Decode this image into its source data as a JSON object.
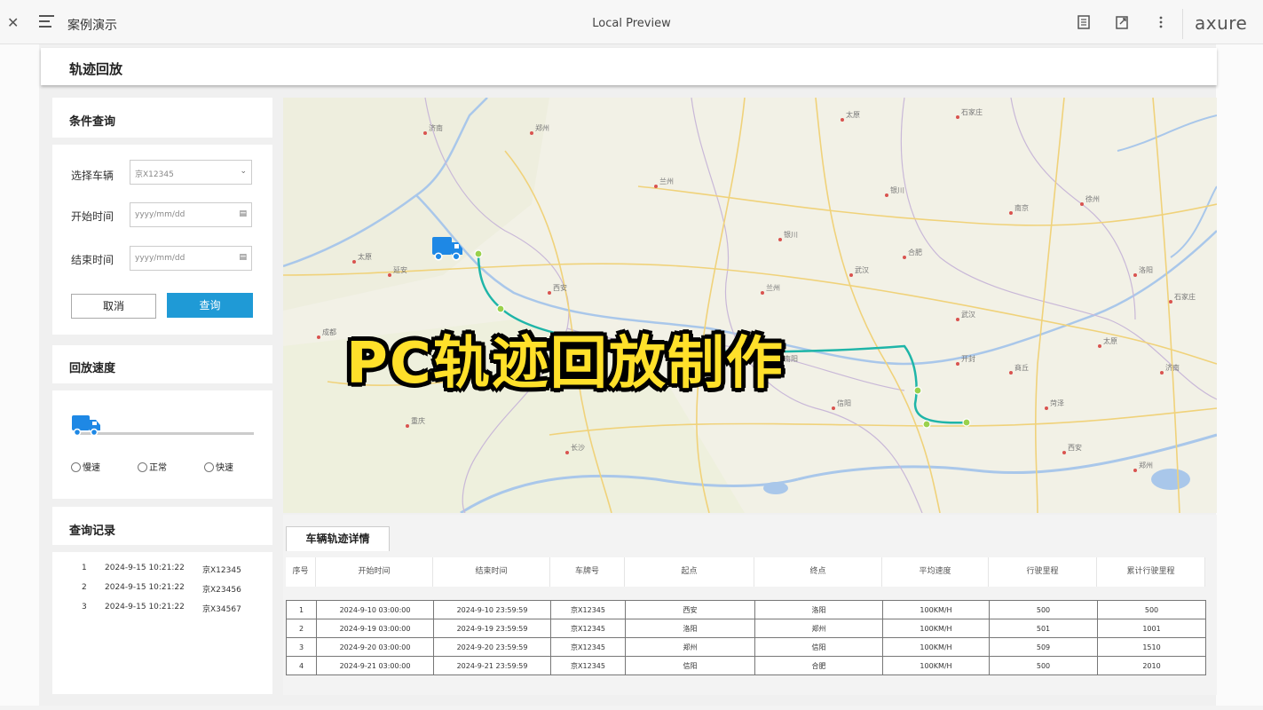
{
  "window": {
    "app_title": "案例演示",
    "center_title": "Local Preview",
    "brand": "axure",
    "icons": [
      "close-icon",
      "menu-icon",
      "document-icon",
      "export-icon",
      "more-icon"
    ]
  },
  "page": {
    "title": "轨迹回放"
  },
  "query_panel": {
    "title": "条件查询",
    "vehicle_label": "选择车辆",
    "vehicle_value": "京X12345",
    "start_label": "开始时间",
    "start_placeholder": "yyyy/mm/dd",
    "end_label": "结束时间",
    "end_placeholder": "yyyy/mm/dd",
    "cancel_label": "取消",
    "query_label": "查询"
  },
  "speed_panel": {
    "title": "回放速度",
    "options": [
      "慢速",
      "正常",
      "快速"
    ],
    "progress": 0
  },
  "history_panel": {
    "title": "查询记录",
    "records": [
      {
        "index": "1",
        "time": "2024-9-15  10:21:22",
        "plate": "京X12345"
      },
      {
        "index": "2",
        "time": "2024-9-15  10:21:22",
        "plate": "京X23456"
      },
      {
        "index": "3",
        "time": "2024-9-15  10:21:22",
        "plate": "京X34567"
      }
    ]
  },
  "map": {
    "overlay_text": "PC轨迹回放制作",
    "route_color": "#1fb5a8",
    "labels": [
      "太原",
      "石家庄",
      "济南",
      "郑州",
      "西安",
      "兰州",
      "银川",
      "武汉",
      "合肥",
      "南京",
      "徐州",
      "洛阳",
      "太原",
      "延安",
      "成都",
      "重庆",
      "长沙",
      "南阳",
      "信阳",
      "开封",
      "商丘",
      "菏泽"
    ]
  },
  "detail": {
    "tab_label": "车辆轨迹详情",
    "columns": [
      "序号",
      "开始时间",
      "结束时间",
      "车牌号",
      "起点",
      "终点",
      "平均速度",
      "行驶里程",
      "累计行驶里程"
    ],
    "rows": [
      [
        "1",
        "2024-9-10  03:00:00",
        "2024-9-10  23:59:59",
        "京X12345",
        "西安",
        "洛阳",
        "100KM/H",
        "500",
        "500"
      ],
      [
        "2",
        "2024-9-19  03:00:00",
        "2024-9-19  23:59:59",
        "京X12345",
        "洛阳",
        "郑州",
        "100KM/H",
        "501",
        "1001"
      ],
      [
        "3",
        "2024-9-20  03:00:00",
        "2024-9-20  23:59:59",
        "京X12345",
        "郑州",
        "信阳",
        "100KM/H",
        "509",
        "1510"
      ],
      [
        "4",
        "2024-9-21  03:00:00",
        "2024-9-21  23:59:59",
        "京X12345",
        "信阳",
        "合肥",
        "100KM/H",
        "500",
        "2010"
      ]
    ]
  },
  "colors": {
    "accent": "#1f9ad6",
    "truck": "#1e88e5",
    "overlay_text": "#ffe02a",
    "route": "#1fb5a8"
  }
}
